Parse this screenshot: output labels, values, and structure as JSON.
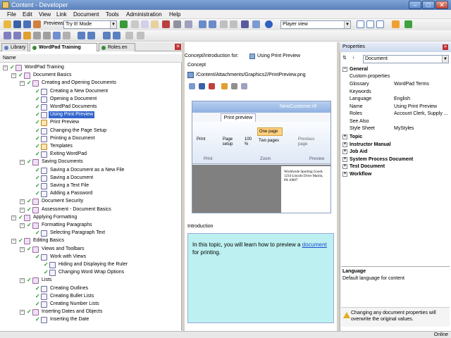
{
  "window": {
    "title": "Content - Developer"
  },
  "menu": [
    "File",
    "Edit",
    "View",
    "Link",
    "Document",
    "Tools",
    "Administration",
    "Help"
  ],
  "toolbar": {
    "previews_label": "Previews",
    "mode_value": "Try It! Mode",
    "view_value": "Player view"
  },
  "tabs": [
    {
      "label": "Library"
    },
    {
      "label": "WordPad Training"
    },
    {
      "label": "Roles.en"
    }
  ],
  "tree": {
    "header": "Name",
    "nodes": [
      {
        "label": "WordPad Training",
        "level": 0
      },
      {
        "label": "Document Basics",
        "level": 1
      },
      {
        "label": "Creating and Opening Documents",
        "level": 2
      },
      {
        "label": "Creating a New Document",
        "level": 3
      },
      {
        "label": "Opening a Document",
        "level": 3
      },
      {
        "label": "WordPad Documents",
        "level": 3
      },
      {
        "label": "Using Print Preview",
        "level": 3,
        "selected": true
      },
      {
        "label": "Print Preview",
        "level": 3
      },
      {
        "label": "Changing the Page Setup",
        "level": 3
      },
      {
        "label": "Printing a Document",
        "level": 3
      },
      {
        "label": "Templates",
        "level": 3
      },
      {
        "label": "Exiting WordPad",
        "level": 3
      },
      {
        "label": "Saving Documents",
        "level": 2
      },
      {
        "label": "Saving a Document as a New File",
        "level": 3
      },
      {
        "label": "Saving a Document",
        "level": 3
      },
      {
        "label": "Saving a Text File",
        "level": 3
      },
      {
        "label": "Adding a Password",
        "level": 3
      },
      {
        "label": "Document Security",
        "level": 2
      },
      {
        "label": "Assessment - Document Basics",
        "level": 2
      },
      {
        "label": "Applying Formatting",
        "level": 1
      },
      {
        "label": "Formatting Paragraphs",
        "level": 2
      },
      {
        "label": "Selecting Paragraph Text",
        "level": 3
      },
      {
        "label": "Editing Basics",
        "level": 1
      },
      {
        "label": "Views and Toolbars",
        "level": 2
      },
      {
        "label": "Work with Views",
        "level": 3
      },
      {
        "label": "Hiding and Displaying the Ruler",
        "level": 4
      },
      {
        "label": "Changing Word Wrap Options",
        "level": 4
      },
      {
        "label": "Lists",
        "level": 2
      },
      {
        "label": "Creating Outlines",
        "level": 3
      },
      {
        "label": "Creating Bullet Lists",
        "level": 3
      },
      {
        "label": "Creating Number Lists",
        "level": 3
      },
      {
        "label": "Inserting Dates and Objects",
        "level": 2
      },
      {
        "label": "Inserting the Date",
        "level": 3
      }
    ]
  },
  "concept": {
    "header_label": "Concept/Introduction for:",
    "header_value": "Using Print Preview",
    "section_label": "Concept",
    "path": "/Content/Attachments/Graphics2/PrintPreview.png",
    "preview": {
      "doc_title": "NewCustomer.rtf",
      "tab": "Print preview",
      "buttons": [
        "Print",
        "Page setup",
        "100 %",
        "One page",
        "Two pages",
        "Previous page"
      ],
      "groups": [
        "Print",
        "Zoom",
        "Preview"
      ],
      "page_text": "Worldwide Sporting Goods 1234 Lincoln Drive Martin, PA 10007"
    }
  },
  "intro": {
    "label": "Introduction",
    "text_before": "In this topic, you will learn how to preview a",
    "link": "document",
    "text_after": "for printing."
  },
  "properties": {
    "title": "Properties",
    "selector": "Document",
    "general_label": "General",
    "custom_label": "Custom properties",
    "rows": [
      {
        "k": "Glossary",
        "v": "WordPad Terms"
      },
      {
        "k": "Keywords",
        "v": ""
      },
      {
        "k": "Language",
        "v": "English"
      },
      {
        "k": "Name",
        "v": "Using Print Preview"
      },
      {
        "k": "Roles",
        "v": "Account Clerk, Supply ..."
      },
      {
        "k": "See Also",
        "v": ""
      },
      {
        "k": "Style Sheet",
        "v": "MyStyles"
      }
    ],
    "groups": [
      "Topic",
      "Instructor Manual",
      "Job Aid",
      "System Process Document",
      "Test Document",
      "Workflow"
    ],
    "desc_title": "Language",
    "desc_text": "Default language for content",
    "warning": "Changing any document properties will overwrite the original values."
  },
  "status": {
    "mode": "Online"
  }
}
